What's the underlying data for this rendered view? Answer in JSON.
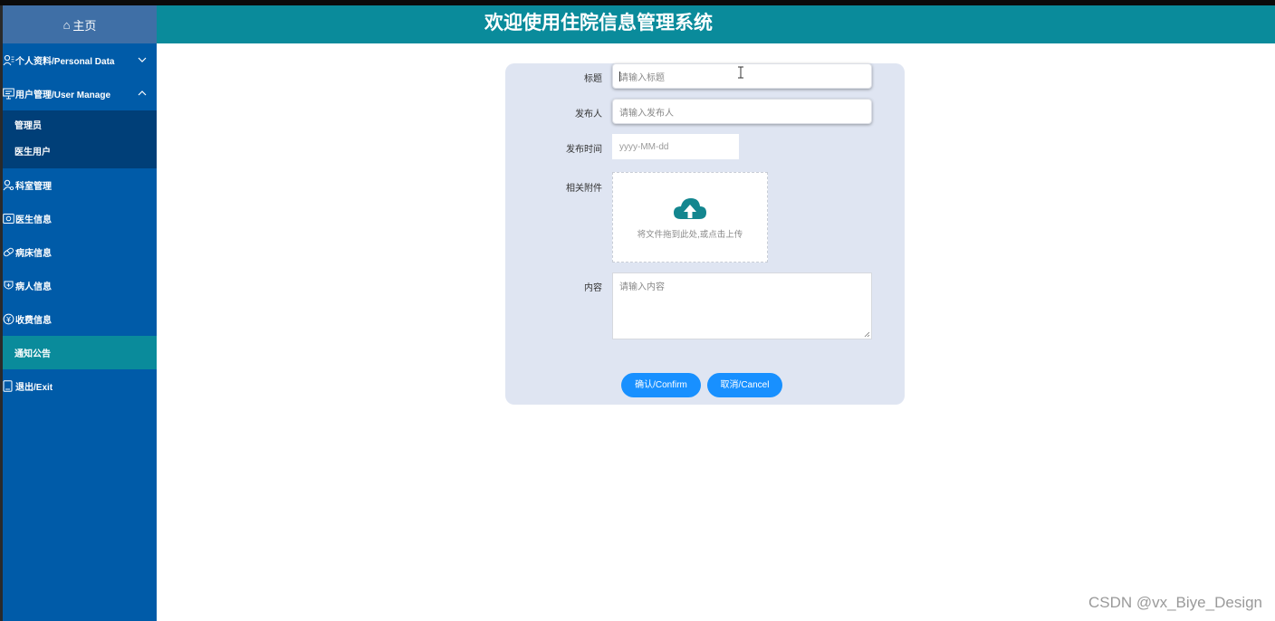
{
  "header": {
    "home_label": "主页",
    "title": "欢迎使用住院信息管理系统"
  },
  "sidebar": {
    "items": [
      {
        "label": "个人资料/Personal Data",
        "icon": "user-settings-icon",
        "expanded": false
      },
      {
        "label": "用户管理/User Manage",
        "icon": "monitor-icon",
        "expanded": true,
        "children": [
          {
            "label": "管理员"
          },
          {
            "label": "医生用户"
          }
        ]
      },
      {
        "label": "科室管理",
        "icon": "person-search-icon"
      },
      {
        "label": "医生信息",
        "icon": "doctor-card-icon"
      },
      {
        "label": "病床信息",
        "icon": "bed-bandage-icon"
      },
      {
        "label": "病人信息",
        "icon": "patient-icon"
      },
      {
        "label": "收费信息",
        "icon": "coin-icon"
      },
      {
        "label": "通知公告",
        "icon": "",
        "active": true
      },
      {
        "label": "退出/Exit",
        "icon": "exit-icon"
      }
    ]
  },
  "form": {
    "title_label": "标题",
    "title_placeholder": "请输入标题",
    "publisher_label": "发布人",
    "publisher_placeholder": "请输入发布人",
    "time_label": "发布时间",
    "time_placeholder": "yyyy-MM-dd",
    "attachment_label": "相关附件",
    "upload_text": "将文件拖到此处,或点击上传",
    "content_label": "内容",
    "content_placeholder": "请输入内容",
    "confirm_label": "确认/Confirm",
    "cancel_label": "取消/Cancel"
  },
  "colors": {
    "header_bg": "#0a8b9b",
    "sidebar_bg": "#005ba8",
    "submenu_bg": "#003f78",
    "active_bg": "#0a8b9b",
    "card_bg": "#dfe5f2",
    "button_bg": "#1890ff",
    "upload_icon": "#13868f"
  },
  "watermark": "CSDN @vx_Biye_Design"
}
